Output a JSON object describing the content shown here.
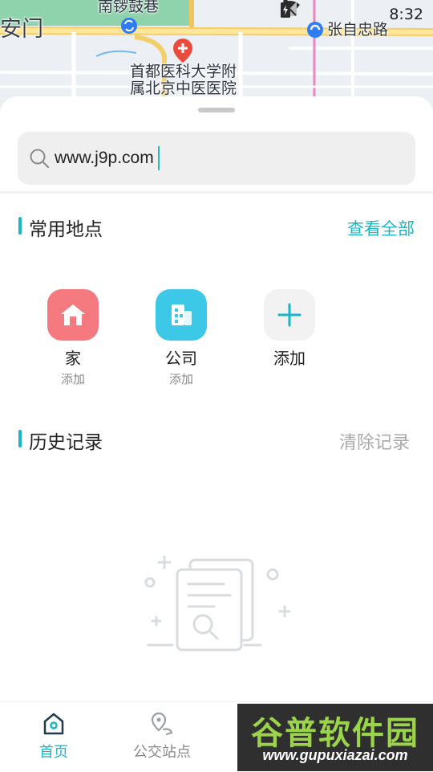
{
  "status_bar": {
    "time": "8:32"
  },
  "map": {
    "labels": {
      "gate": "安门",
      "alley": "南锣鼓巷",
      "hospital_line1": "首都医科大学附",
      "hospital_line2": "属北京中医医院",
      "road": "张自忠路"
    }
  },
  "search": {
    "value": "www.j9p.com"
  },
  "frequent": {
    "title": "常用地点",
    "view_all": "查看全部",
    "items": [
      {
        "name": "家",
        "sub": "添加",
        "icon": "home-icon"
      },
      {
        "name": "公司",
        "sub": "添加",
        "icon": "building-icon"
      },
      {
        "name": "添加",
        "icon": "plus-icon"
      }
    ]
  },
  "history": {
    "title": "历史记录",
    "clear": "清除记录"
  },
  "nav": [
    {
      "label": "首页",
      "icon": "home-outline-icon",
      "active": true
    },
    {
      "label": "公交站点",
      "icon": "location-route-icon",
      "active": false
    }
  ],
  "watermark": {
    "title": "谷普软件园",
    "url": "www.gupuxiazai.com"
  },
  "colors": {
    "accent": "#19b6c4",
    "home_icon": "#f47a7f",
    "company_icon": "#3ec8e8",
    "muted": "#aaaaaa"
  }
}
